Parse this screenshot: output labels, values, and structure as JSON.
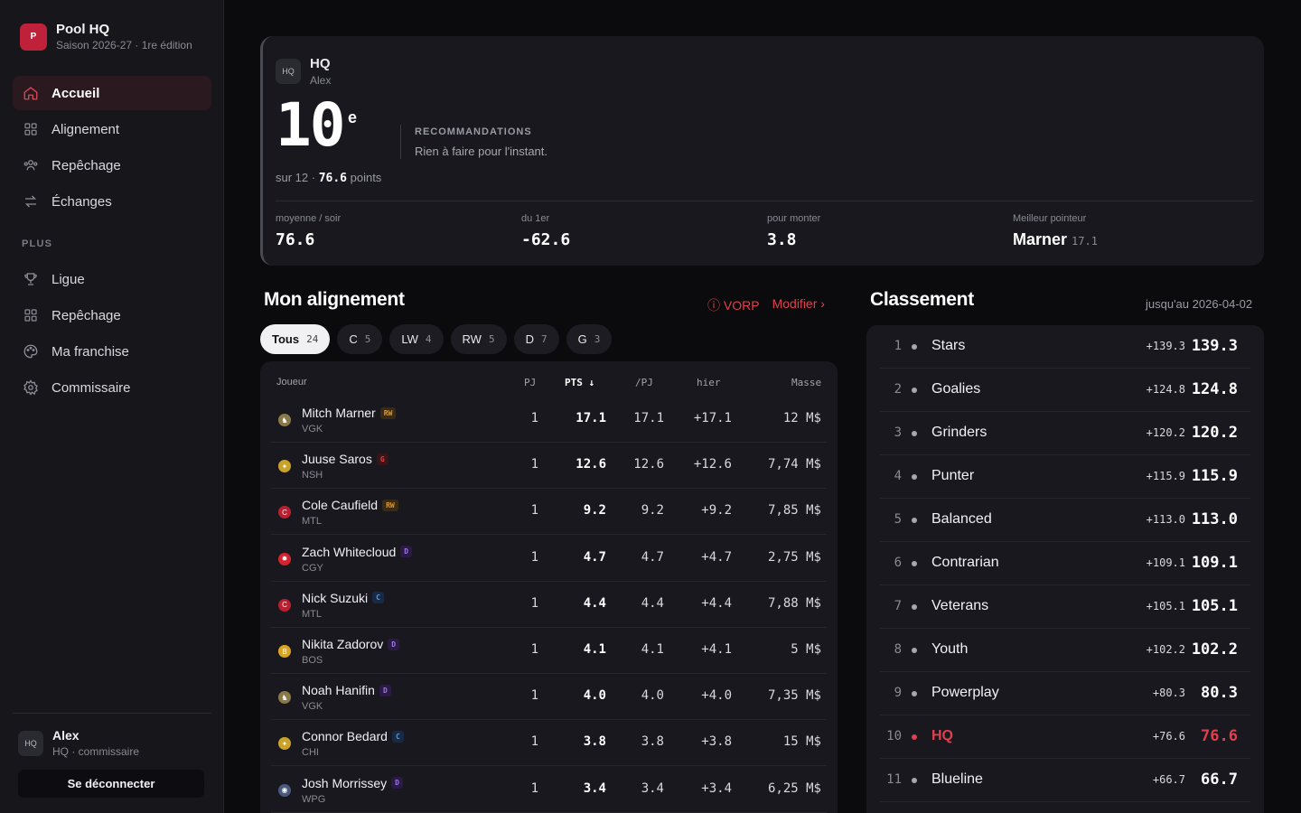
{
  "app": {
    "logo_letter": "P",
    "name": "Pool HQ",
    "season": "Saison 2026-27 · 1re édition"
  },
  "nav": {
    "primary": [
      {
        "label": "Accueil",
        "icon": "home-icon",
        "active": true
      },
      {
        "label": "Alignement",
        "icon": "grid-icon"
      },
      {
        "label": "Repêchage",
        "icon": "users-icon"
      },
      {
        "label": "Échanges",
        "icon": "swap-icon"
      }
    ],
    "section_label": "PLUS",
    "secondary": [
      {
        "label": "Ligue",
        "icon": "trophy-icon"
      },
      {
        "label": "Repêchage",
        "icon": "grid-icon"
      },
      {
        "label": "Ma franchise",
        "icon": "palette-icon"
      },
      {
        "label": "Commissaire",
        "icon": "gear-icon"
      }
    ]
  },
  "user": {
    "avatar": "HQ",
    "name": "Alex",
    "role": "HQ · commissaire",
    "logout_label": "Se déconnecter"
  },
  "hero": {
    "team_logo": "HQ",
    "team_name": "HQ",
    "owner": "Alex",
    "rank": "10",
    "rank_suffix": "e",
    "rank_sub_prefix": "sur 12 · ",
    "rank_points": "76.6",
    "rank_sub_suffix": " points",
    "reco_title": "RECOMMANDATIONS",
    "reco_text": "Rien à faire pour l'instant.",
    "stats": [
      {
        "label": "moyenne / soir",
        "value": "76.6"
      },
      {
        "label": "du 1er",
        "value": "-62.6"
      },
      {
        "label": "pour monter",
        "value": "3.8"
      },
      {
        "label": "Meilleur pointeur",
        "value": "Marner",
        "sub": "17.1"
      }
    ]
  },
  "lineup": {
    "title": "Mon alignement",
    "vorp_label": "ⓘ VORP",
    "edit_label": "Modifier ›",
    "filters": [
      {
        "label": "Tous",
        "count": "24",
        "active": true
      },
      {
        "label": "C",
        "count": "5"
      },
      {
        "label": "LW",
        "count": "4"
      },
      {
        "label": "RW",
        "count": "5"
      },
      {
        "label": "D",
        "count": "7"
      },
      {
        "label": "G",
        "count": "3"
      }
    ],
    "columns": {
      "player": "Joueur",
      "gp": "PJ",
      "pts": "PTS ↓",
      "ppg": "/PJ",
      "yesterday": "hier",
      "salary": "Masse"
    },
    "rows": [
      {
        "name": "Mitch Marner",
        "pos": "RW",
        "team": "VGK",
        "gp": "1",
        "pts": "17.1",
        "ppg": "17.1",
        "yesterday": "+17.1",
        "salary": "12 M$",
        "logo_color": "#8a7a4a",
        "logo_glyph": "♞"
      },
      {
        "name": "Juuse Saros",
        "pos": "G",
        "team": "NSH",
        "gp": "1",
        "pts": "12.6",
        "ppg": "12.6",
        "yesterday": "+12.6",
        "salary": "7,74 M$",
        "logo_color": "#c9a227",
        "logo_glyph": "✦"
      },
      {
        "name": "Cole Caufield",
        "pos": "RW",
        "team": "MTL",
        "gp": "1",
        "pts": "9.2",
        "ppg": "9.2",
        "yesterday": "+9.2",
        "salary": "7,85 M$",
        "logo_color": "#b8202f",
        "logo_glyph": "C"
      },
      {
        "name": "Zach Whitecloud",
        "pos": "D",
        "team": "CGY",
        "gp": "1",
        "pts": "4.7",
        "ppg": "4.7",
        "yesterday": "+4.7",
        "salary": "2,75 M$",
        "logo_color": "#d4222e",
        "logo_glyph": "✹"
      },
      {
        "name": "Nick Suzuki",
        "pos": "C",
        "team": "MTL",
        "gp": "1",
        "pts": "4.4",
        "ppg": "4.4",
        "yesterday": "+4.4",
        "salary": "7,88 M$",
        "logo_color": "#b8202f",
        "logo_glyph": "C"
      },
      {
        "name": "Nikita Zadorov",
        "pos": "D",
        "team": "BOS",
        "gp": "1",
        "pts": "4.1",
        "ppg": "4.1",
        "yesterday": "+4.1",
        "salary": "5 M$",
        "logo_color": "#d9a520",
        "logo_glyph": "B"
      },
      {
        "name": "Noah Hanifin",
        "pos": "D",
        "team": "VGK",
        "gp": "1",
        "pts": "4.0",
        "ppg": "4.0",
        "yesterday": "+4.0",
        "salary": "7,35 M$",
        "logo_color": "#8a7a4a",
        "logo_glyph": "♞"
      },
      {
        "name": "Connor Bedard",
        "pos": "C",
        "team": "CHI",
        "gp": "1",
        "pts": "3.8",
        "ppg": "3.8",
        "yesterday": "+3.8",
        "salary": "15 M$",
        "logo_color": "#c9a227",
        "logo_glyph": "✦"
      },
      {
        "name": "Josh Morrissey",
        "pos": "D",
        "team": "WPG",
        "gp": "1",
        "pts": "3.4",
        "ppg": "3.4",
        "yesterday": "+3.4",
        "salary": "6,25 M$",
        "logo_color": "#4a5a7a",
        "logo_glyph": "◉"
      }
    ]
  },
  "pos_colors": {
    "RW": {
      "bg": "#3a2a12",
      "fg": "#d89a3a"
    },
    "G": {
      "bg": "#3a1518",
      "fg": "#e0404d"
    },
    "D": {
      "bg": "#2a1a45",
      "fg": "#9a7ae0"
    },
    "C": {
      "bg": "#172a45",
      "fg": "#5a9ae0"
    }
  },
  "standings": {
    "title": "Classement",
    "date": "jusqu'au 2026-04-02",
    "rows": [
      {
        "rank": "1",
        "name": "Stars",
        "delta": "+139.3",
        "pts": "139.3"
      },
      {
        "rank": "2",
        "name": "Goalies",
        "delta": "+124.8",
        "pts": "124.8"
      },
      {
        "rank": "3",
        "name": "Grinders",
        "delta": "+120.2",
        "pts": "120.2"
      },
      {
        "rank": "4",
        "name": "Punter",
        "delta": "+115.9",
        "pts": "115.9"
      },
      {
        "rank": "5",
        "name": "Balanced",
        "delta": "+113.0",
        "pts": "113.0"
      },
      {
        "rank": "6",
        "name": "Contrarian",
        "delta": "+109.1",
        "pts": "109.1"
      },
      {
        "rank": "7",
        "name": "Veterans",
        "delta": "+105.1",
        "pts": "105.1"
      },
      {
        "rank": "8",
        "name": "Youth",
        "delta": "+102.2",
        "pts": "102.2"
      },
      {
        "rank": "9",
        "name": "Powerplay",
        "delta": "+80.3",
        "pts": "80.3"
      },
      {
        "rank": "10",
        "name": "HQ",
        "delta": "+76.6",
        "pts": "76.6",
        "me": true
      },
      {
        "rank": "11",
        "name": "Blueline",
        "delta": "+66.7",
        "pts": "66.7"
      }
    ]
  },
  "colors": {
    "accent": "#e0404d",
    "brand": "#c0213a"
  }
}
